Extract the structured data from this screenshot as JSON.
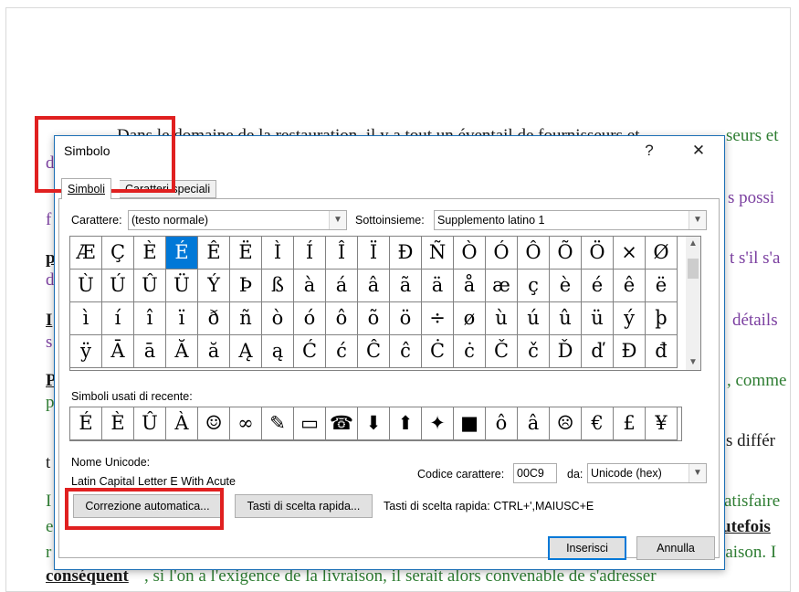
{
  "document": {
    "lines": [
      {
        "text": "Dans le domaine de la restauration, il y a tout un éventail de fournisseurs et",
        "color": "#1a1a1a"
      },
      {
        "text": "seurs et",
        "color": "#2e7d32"
      },
      {
        "text": "d",
        "color": "#7b3fa0"
      },
      {
        "text": "s possi",
        "color": "#7b3fa0"
      },
      {
        "text": "f",
        "color": "#7b3fa0"
      },
      {
        "text": "t s'il s'a",
        "color": "#7b3fa0"
      },
      {
        "text": "p",
        "color": "#1a1a1a"
      },
      {
        "text": "d",
        "color": "#7b3fa0"
      },
      {
        "text": "détails",
        "color": "#7b3fa0"
      },
      {
        "text": "I",
        "color": "#1a1a1a"
      },
      {
        "text": "s",
        "color": "#7b3fa0"
      },
      {
        "text": ", comme",
        "color": "#2e7d32"
      },
      {
        "text": "P",
        "color": "#1a1a1a"
      },
      {
        "text": "p",
        "color": "#2e7d32"
      },
      {
        "text": "s différ",
        "color": "#1a1a1a"
      },
      {
        "text": "t",
        "color": "#1a1a1a"
      },
      {
        "text": "atisfaire",
        "color": "#2e7d32"
      },
      {
        "text": "I",
        "color": "#2e7d32"
      },
      {
        "text": "e",
        "color": "#2e7d32"
      },
      {
        "text": "utefois",
        "color": "#1a1a1a"
      },
      {
        "text": "r",
        "color": "#2e7d32"
      },
      {
        "text": "raison. I",
        "color": "#2e7d32"
      },
      {
        "text": "conséquent",
        "color": "#1a1a1a"
      },
      {
        "text": ", si l'on a l'exigence de la livraison, il serait alors convenable de s'adresser",
        "color": "#2e7d32"
      }
    ]
  },
  "dialog": {
    "title": "Simbolo",
    "help_label": "?",
    "close_label": "✕",
    "tabs": [
      {
        "label": "Simboli",
        "active": true
      },
      {
        "label": "Caratteri speciali",
        "active": false
      }
    ],
    "font_label": "Carattere:",
    "font_value": "(testo normale)",
    "subset_label": "Sottoinsieme:",
    "subset_value": "Supplemento latino 1",
    "symbols": [
      "Æ",
      "Ç",
      "È",
      "É",
      "Ê",
      "Ë",
      "Ì",
      "Í",
      "Î",
      "Ï",
      "Ð",
      "Ñ",
      "Ò",
      "Ó",
      "Ô",
      "Õ",
      "Ö",
      "×",
      "Ø",
      "Ù",
      "Ú",
      "Û",
      "Ü",
      "Ý",
      "Þ",
      "ß",
      "à",
      "á",
      "â",
      "ã",
      "ä",
      "å",
      "æ",
      "ç",
      "è",
      "é",
      "ê",
      "ë",
      "ì",
      "í",
      "î",
      "ï",
      "ð",
      "ñ",
      "ò",
      "ó",
      "ô",
      "õ",
      "ö",
      "÷",
      "ø",
      "ù",
      "ú",
      "û",
      "ü",
      "ý",
      "þ",
      "ÿ",
      "Ā",
      "ā",
      "Ă",
      "ă",
      "Ą",
      "ą",
      "Ć",
      "ć",
      "Ĉ",
      "ĉ",
      "Ċ",
      "ċ",
      "Č",
      "č",
      "Ď",
      "ď",
      "Đ",
      "đ"
    ],
    "selected_symbol_index": 3,
    "recent_label": "Simboli usati di recente:",
    "recent_symbols": [
      "É",
      "È",
      "Û",
      "À",
      "☺",
      "∞",
      "✎",
      "▭",
      "☎",
      "⬇",
      "⬆",
      "✦",
      "■",
      "ô",
      "â",
      "☹",
      "€",
      "£",
      "¥"
    ],
    "unicode_name_label": "Nome Unicode:",
    "unicode_name_value": "Latin Capital Letter E With Acute",
    "char_code_label": "Codice carattere:",
    "char_code_value": "00C9",
    "from_label": "da:",
    "from_value": "Unicode (hex)",
    "autocorrect_label": "Correzione automatica...",
    "shortcut_key_label": "Tasti di scelta rapida...",
    "shortcut_text": "Tasti di scelta rapida: CTRL+',MAIUSC+E",
    "insert_label": "Inserisci",
    "cancel_label": "Annulla"
  },
  "annotations": {
    "highlight_color": "#e02020"
  }
}
